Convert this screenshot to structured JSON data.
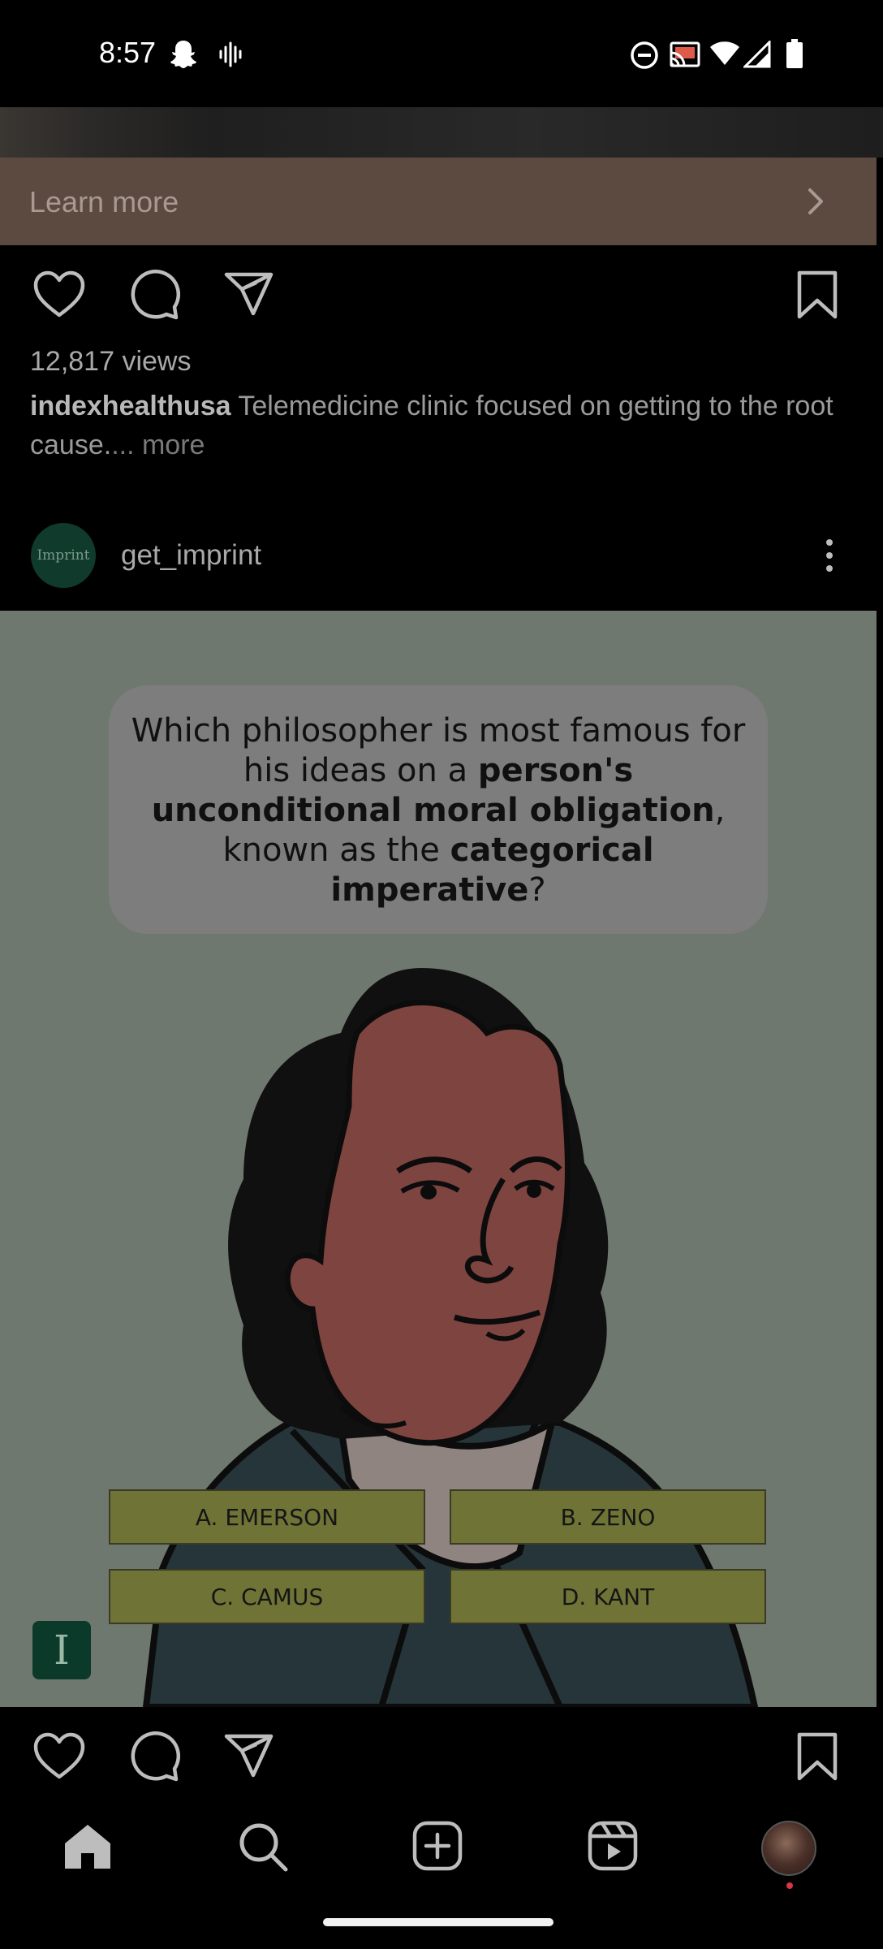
{
  "status_bar": {
    "time": "8:57",
    "left_icons": [
      "snapchat-icon",
      "voice-wave-icon"
    ],
    "right_icons": [
      "do-not-disturb-icon",
      "cast-icon",
      "wifi-icon",
      "signal-icon",
      "battery-icon"
    ]
  },
  "ad": {
    "cta_label": "Learn more"
  },
  "post1": {
    "views": "12,817 views",
    "username": "indexhealthusa",
    "caption": "Telemedicine clinic focused on getting to the root cause.",
    "more_label": "... more"
  },
  "post2": {
    "avatar_text": "Imprint",
    "username": "get_imprint",
    "question": {
      "part1": "Which philosopher is most famous for his ideas on a ",
      "bold1": "person's unconditional moral obligation",
      "part2": ", known as the ",
      "bold2": "categorical imperative",
      "part3": "?"
    },
    "answers": [
      "A. EMERSON",
      "B. ZENO",
      "C. CAMUS",
      "D. KANT"
    ],
    "brand_badge": "I"
  },
  "bottom_nav": {
    "items": [
      "home-icon",
      "search-icon",
      "create-icon",
      "reels-icon",
      "profile-avatar"
    ]
  }
}
